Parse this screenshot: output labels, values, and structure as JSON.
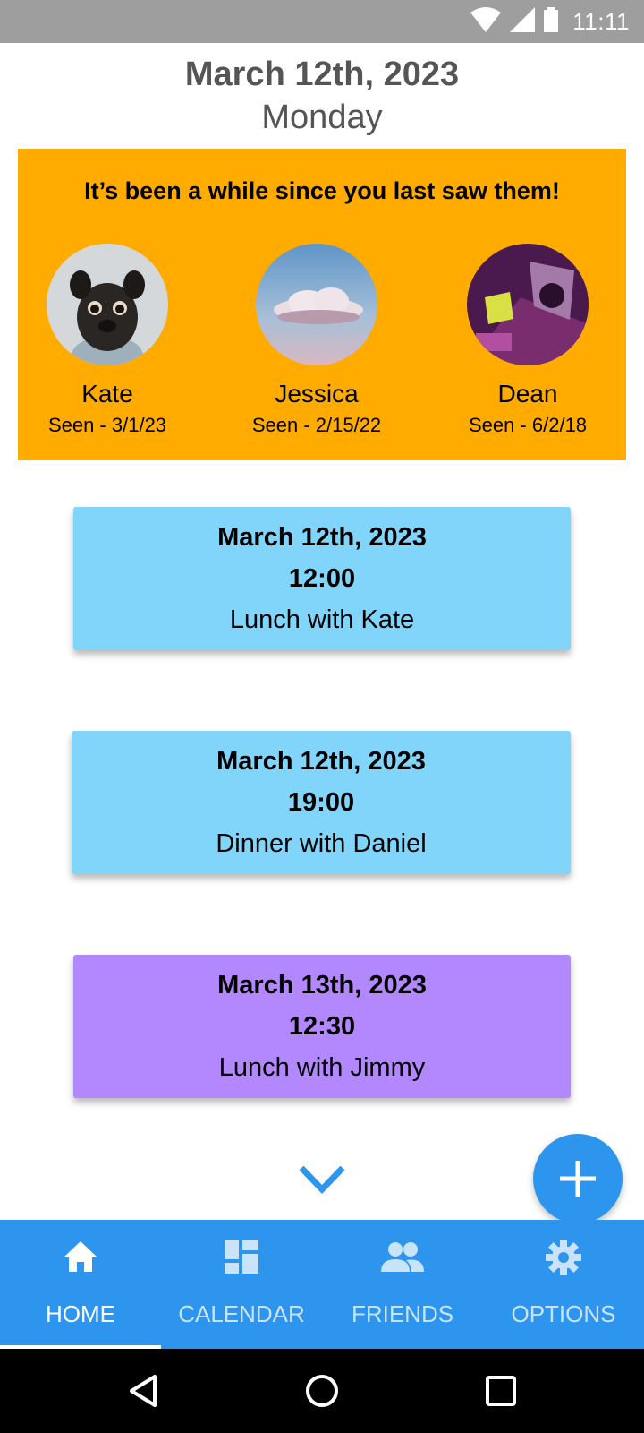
{
  "status_bar": {
    "time": "11:11",
    "icons": [
      "wifi-icon",
      "signal-icon",
      "battery-icon"
    ]
  },
  "header": {
    "date": "March 12th, 2023",
    "day": "Monday"
  },
  "reminder": {
    "heading": "It’s been a while since you last saw them!",
    "friends": [
      {
        "name": "Kate",
        "seen": "Seen - 3/1/23",
        "avatar": "pug-photo"
      },
      {
        "name": "Jessica",
        "seen": "Seen - 2/15/22",
        "avatar": "cloud-photo"
      },
      {
        "name": "Dean",
        "seen": "Seen - 6/2/18",
        "avatar": "purple-room-photo"
      }
    ]
  },
  "events": [
    {
      "date": "March 12th, 2023",
      "time": "12:00",
      "title": "Lunch with Kate",
      "color": "#81d4fa"
    },
    {
      "date": "March 12th, 2023",
      "time": "19:00",
      "title": "Dinner with Daniel",
      "color": "#81d4fa"
    },
    {
      "date": "March 13th, 2023",
      "time": "12:30",
      "title": "Lunch with Jimmy",
      "color": "#b388ff"
    }
  ],
  "nav": {
    "items": [
      {
        "label": "HOME",
        "icon": "home-icon",
        "active": true
      },
      {
        "label": "CALENDAR",
        "icon": "dashboard-icon",
        "active": false
      },
      {
        "label": "FRIENDS",
        "icon": "people-icon",
        "active": false
      },
      {
        "label": "OPTIONS",
        "icon": "gear-icon",
        "active": false
      }
    ]
  },
  "colors": {
    "accent": "#2e95ee",
    "reminder_bg": "#ffab00",
    "status_bar": "#9e9e9e"
  }
}
